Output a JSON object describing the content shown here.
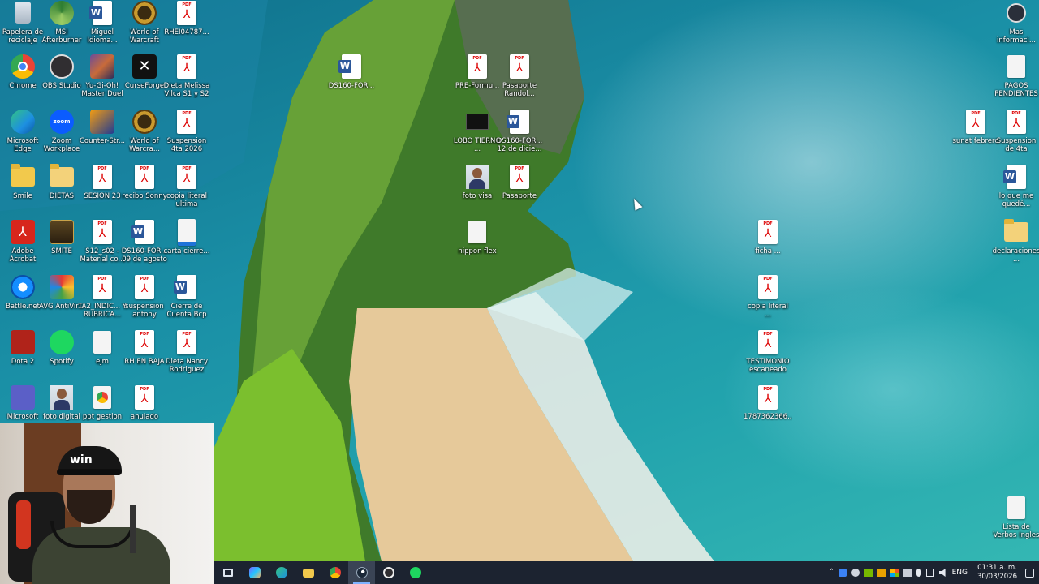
{
  "desktop": {
    "icons": [
      {
        "label": "Papelera de reciclaje",
        "icon": "recycle-bin-icon",
        "kind": "bin"
      },
      {
        "label": "MSI Afterburner",
        "icon": "msi-afterburner-icon",
        "kind": "app-green"
      },
      {
        "label": "Miguel Idioma...",
        "icon": "word-document-icon",
        "kind": "doc"
      },
      {
        "label": "World of Warcraft",
        "icon": "world-of-warcraft-icon",
        "kind": "wow"
      },
      {
        "label": "RHEI04787...",
        "icon": "pdf-file-icon",
        "kind": "pdf"
      },
      {
        "label": "Chrome",
        "icon": "chrome-icon",
        "kind": "chrome"
      },
      {
        "label": "OBS Studio",
        "icon": "obs-studio-icon",
        "kind": "obs"
      },
      {
        "label": "Yu-Gi-Oh! Master Duel",
        "icon": "yugioh-icon",
        "kind": "yugioh"
      },
      {
        "label": "CurseForge",
        "icon": "curseforge-icon",
        "kind": "curse"
      },
      {
        "label": "Dieta Melissa Vilca S1 y S2",
        "icon": "pdf-file-icon",
        "kind": "pdf"
      },
      {
        "label": "Microsoft Edge",
        "icon": "edge-icon",
        "kind": "edge"
      },
      {
        "label": "Zoom Workplace",
        "icon": "zoom-icon",
        "kind": "zoom"
      },
      {
        "label": "Counter-Str...",
        "icon": "counter-strike-icon",
        "kind": "cs"
      },
      {
        "label": "World of Warcra...",
        "icon": "world-of-warcraft-icon",
        "kind": "wow"
      },
      {
        "label": "Suspension 4ta 2026",
        "icon": "pdf-file-icon",
        "kind": "pdf"
      },
      {
        "label": "Smile",
        "icon": "folder-icon",
        "kind": "folder"
      },
      {
        "label": "DIETAS",
        "icon": "folder-icon",
        "kind": "folder2"
      },
      {
        "label": "SESION 23",
        "icon": "pdf-file-icon",
        "kind": "pdf"
      },
      {
        "label": "recibo Sonny",
        "icon": "pdf-file-icon",
        "kind": "pdf"
      },
      {
        "label": "copia literal ultima",
        "icon": "pdf-file-icon",
        "kind": "pdf"
      },
      {
        "label": "Adobe Acrobat",
        "icon": "acrobat-icon",
        "kind": "acrobat"
      },
      {
        "label": "SMITE",
        "icon": "smite-icon",
        "kind": "smite"
      },
      {
        "label": "S12_s02 - Material co...",
        "icon": "pdf-file-icon",
        "kind": "pdf"
      },
      {
        "label": "DS160-FOR... 09 de agosto",
        "icon": "word-document-icon",
        "kind": "doc"
      },
      {
        "label": "carta cierre...",
        "icon": "blank-file-icon",
        "kind": "blankblue"
      },
      {
        "label": "Battle.net",
        "icon": "battlenet-icon",
        "kind": "battlenet"
      },
      {
        "label": "AVG AntiVir...",
        "icon": "avg-icon",
        "kind": "avg"
      },
      {
        "label": "TA2_INDIC... Y RUBRICA...",
        "icon": "pdf-file-icon",
        "kind": "pdf"
      },
      {
        "label": "suspension antony",
        "icon": "pdf-file-icon",
        "kind": "pdf"
      },
      {
        "label": "Cierre de Cuenta Bcp",
        "icon": "word-document-icon",
        "kind": "doc"
      },
      {
        "label": "Dota 2",
        "icon": "dota2-icon",
        "kind": "dota"
      },
      {
        "label": "Spotify",
        "icon": "spotify-icon",
        "kind": "spotify"
      },
      {
        "label": "ejm",
        "icon": "text-file-icon",
        "kind": "blank"
      },
      {
        "label": "RH EN BAJA",
        "icon": "pdf-file-icon",
        "kind": "pdf"
      },
      {
        "label": "Dieta Nancy Rodriguez",
        "icon": "pdf-file-icon",
        "kind": "pdf"
      },
      {
        "label": "Microsoft",
        "icon": "teams-icon",
        "kind": "teams"
      },
      {
        "label": "foto digital",
        "icon": "photo-icon",
        "kind": "photo"
      },
      {
        "label": "ppt gestion",
        "icon": "chrome-file-icon",
        "kind": "chromefile"
      },
      {
        "label": "anulado",
        "icon": "pdf-file-icon",
        "kind": "pdf"
      },
      {
        "label": "DS160-FOR...",
        "icon": "word-document-icon",
        "kind": "doc"
      },
      {
        "label": "PRE-Formu...",
        "icon": "pdf-file-icon",
        "kind": "pdf"
      },
      {
        "label": "Pasaporte Randol...",
        "icon": "pdf-file-icon",
        "kind": "pdf"
      },
      {
        "label": "LOBO TIERNO ...",
        "icon": "lobo-icon",
        "kind": "lobo"
      },
      {
        "label": "DS160-FOR... 12 de dicie...",
        "icon": "word-document-icon",
        "kind": "doc"
      },
      {
        "label": "foto visa",
        "icon": "photo-icon",
        "kind": "photo"
      },
      {
        "label": "Pasaporte",
        "icon": "pdf-file-icon",
        "kind": "pdf"
      },
      {
        "label": "nippon flex",
        "icon": "blank-file-icon",
        "kind": "blank"
      },
      {
        "label": "ficha ...",
        "icon": "pdf-file-icon",
        "kind": "pdf"
      },
      {
        "label": "copia literal ...",
        "icon": "pdf-file-icon",
        "kind": "pdf"
      },
      {
        "label": "TESTIMONIO escaneado",
        "icon": "pdf-file-icon",
        "kind": "pdf"
      },
      {
        "label": "1787362366...",
        "icon": "pdf-file-icon",
        "kind": "pdf"
      },
      {
        "label": "Mas informaci...",
        "icon": "help-icon",
        "kind": "help"
      },
      {
        "label": "PAGOS PENDIENTES",
        "icon": "blank-file-icon",
        "kind": "blank"
      },
      {
        "label": "sunat febrero",
        "icon": "pdf-file-icon",
        "kind": "pdf"
      },
      {
        "label": "Suspension de 4ta",
        "icon": "pdf-file-icon",
        "kind": "pdf"
      },
      {
        "label": "lo que me quedé...",
        "icon": "word-document-icon",
        "kind": "doc"
      },
      {
        "label": "declaraciones ...",
        "icon": "folder-icon",
        "kind": "folder2"
      },
      {
        "label": "Lista de Verbos Ingles",
        "icon": "blank-file-icon",
        "kind": "blank"
      }
    ]
  },
  "taskbar": {
    "apps": [
      {
        "name": "task-view-button",
        "icon": "task-view-icon",
        "color": "#dfe6f0"
      },
      {
        "name": "copilot-button",
        "icon": "copilot-icon",
        "color": "#7b61ff"
      },
      {
        "name": "edge-button",
        "icon": "edge-icon",
        "color": "#1fa0e0"
      },
      {
        "name": "file-explorer-button",
        "icon": "folder-icon",
        "color": "#f2c94c"
      },
      {
        "name": "chrome-button",
        "icon": "chrome-icon",
        "color": "#e94235"
      },
      {
        "name": "steam-button",
        "icon": "steam-icon",
        "color": "#1b2838",
        "active": true
      },
      {
        "name": "obs-button",
        "icon": "obs-icon",
        "color": "#302e31"
      },
      {
        "name": "spotify-button",
        "icon": "spotify-icon",
        "color": "#1ed760"
      }
    ],
    "tray": {
      "language": "ENG",
      "time": "01:31 a. m.",
      "date": "30/03/2026"
    }
  },
  "colors": {
    "taskbar_bg": "#1c2330",
    "pdf_red": "#d00000",
    "word_blue": "#2b579a"
  }
}
